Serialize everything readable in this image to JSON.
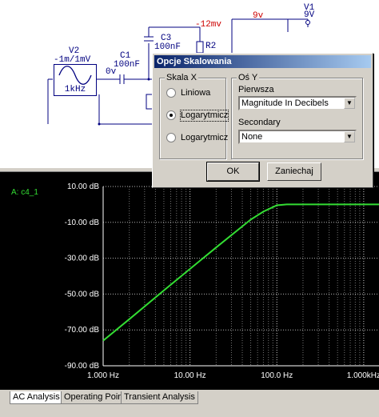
{
  "schematic": {
    "v2_name": "V2",
    "v2_value": "-1m/1mV",
    "v2_freq": "1kHz",
    "c1_name": "C1",
    "c1_value": "100nF",
    "c3_name": "C3",
    "c3_value": "100nF",
    "r2_name": "R2",
    "v1_name": "V1",
    "v1_value": "9V",
    "net_0v": "0v",
    "net_12mv": "-12mv",
    "net_9v": "9v"
  },
  "dialog": {
    "title": "Opcje Skalowania",
    "x_group_title": "Skala X",
    "x_options": [
      "Liniowa",
      "Logarytmicz",
      "Logarytmicz"
    ],
    "x_selected": 1,
    "y_group_title": "Oś Y",
    "primary_label": "Pierwsza",
    "primary_value": "Magnitude In Decibels",
    "secondary_label": "Secondary",
    "secondary_value": "None",
    "ok_label": "OK",
    "cancel_label": "Zaniechaj"
  },
  "plot": {
    "trace_label": "A: c4_1",
    "trace_color": "#33dd33",
    "background": "#000000"
  },
  "chart_data": {
    "type": "line",
    "x_scale": "log",
    "x_ticks": [
      1,
      10,
      100,
      1000
    ],
    "x_tick_labels": [
      "1.000 Hz",
      "10.00 Hz",
      "100.0 Hz",
      "1.000kHz"
    ],
    "y_ticks": [
      10,
      -10,
      -30,
      -50,
      -70,
      -90
    ],
    "y_tick_labels": [
      "10.00 dB",
      "-10.00 dB",
      "-30.00 dB",
      "-50.00 dB",
      "-70.00 dB",
      "-90.00 dB"
    ],
    "xlim": [
      1,
      1500
    ],
    "ylim": [
      -90,
      10
    ],
    "grid": true,
    "series": [
      {
        "x": [
          1,
          2,
          5,
          10,
          20,
          50,
          70,
          100,
          130,
          200,
          500,
          1000,
          1500
        ],
        "y": [
          -76,
          -64,
          -48,
          -36,
          -24,
          -8.5,
          -4,
          -0.5,
          0,
          0,
          0,
          0,
          0
        ]
      }
    ]
  },
  "tabs": [
    "AC Analysis",
    "Operating Point",
    "Transient Analysis"
  ]
}
